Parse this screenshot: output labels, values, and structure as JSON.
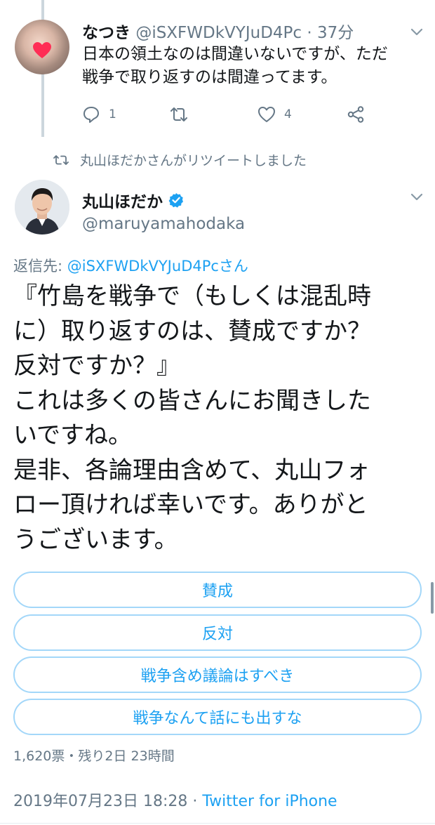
{
  "reply_tweet": {
    "name": "なつき",
    "handle": "@iSXFWDkVYJuD4Pc",
    "time": "37分",
    "separator": " · ",
    "text_line1": "日本の領土なのは間違いないですが、ただ",
    "text_line2": "戦争で取り返すのは間違ってます。",
    "reply_count": "1",
    "like_count": "4"
  },
  "retweet_notice": "丸山ほだかさんがリツイートしました",
  "main_tweet": {
    "name": "丸山ほだか",
    "handle": "@maruyamahodaka",
    "replying_prefix": "返信先: ",
    "replying_to": "@iSXFWDkVYJuD4Pcさん",
    "lines": [
      "『竹島を戦争で（もしくは混乱時",
      "に）取り返すのは、賛成ですか？",
      "反対ですか？』",
      "これは多くの皆さんにお聞きした",
      "いですね。",
      "是非、各論理由含めて、丸山フォ",
      "ロー頂ければ幸いです。ありがと",
      "うございます。"
    ]
  },
  "poll": {
    "options": [
      "賛成",
      "反対",
      "戦争含め議論はすべき",
      "戦争なんて話にも出すな"
    ],
    "meta": "1,620票・残り2日 23時間"
  },
  "footer": {
    "date": "2019年07月23日 18:28",
    "separator": " · ",
    "source": "Twitter for iPhone"
  },
  "colors": {
    "accent": "#1da1f2",
    "muted": "#657786",
    "text": "#14171a",
    "poll_border": "#a3d7f9",
    "thread_line": "#ccd6dd"
  },
  "icons": [
    "reply-icon",
    "retweet-icon",
    "like-icon",
    "share-icon",
    "chevron-down-icon",
    "verified-badge-icon"
  ]
}
